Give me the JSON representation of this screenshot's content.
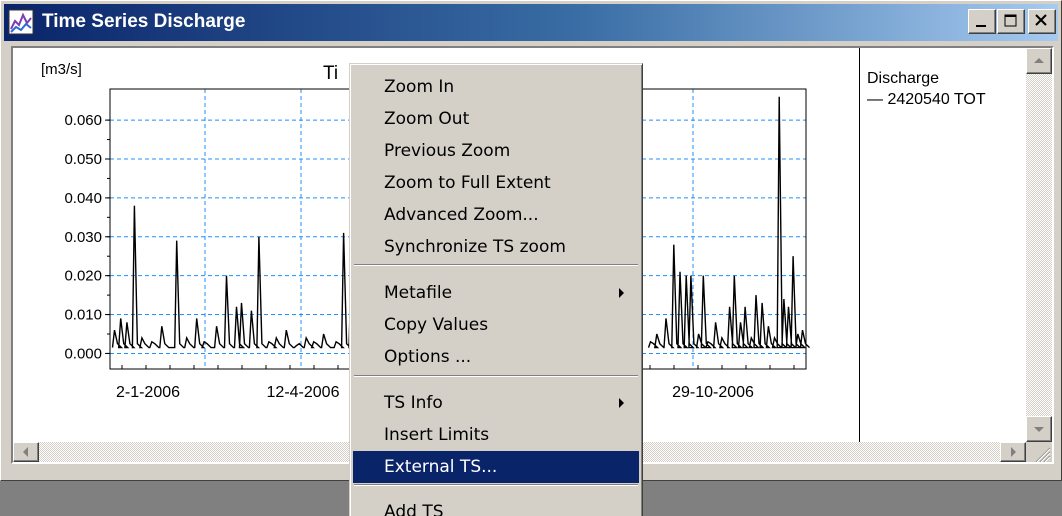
{
  "window": {
    "title": "Time Series Discharge",
    "min_glyph": "_",
    "max_glyph": "□",
    "close_glyph": "✕"
  },
  "chart_data": {
    "type": "line",
    "title": "Ti",
    "ylabel": "[m3/s]",
    "ylim": [
      -0.004,
      0.068
    ],
    "yticks": [
      0.0,
      0.01,
      0.02,
      0.03,
      0.04,
      0.05,
      0.06
    ],
    "ytick_labels": [
      "0.000",
      "0.010",
      "0.020",
      "0.030",
      "0.040",
      "0.050",
      "0.060"
    ],
    "xtick_labels": [
      "2-1-2006",
      "12-4-2006",
      "29-10-2006"
    ],
    "grid": true,
    "legend_title": "Discharge",
    "legend_position": "right",
    "series": [
      {
        "name": "2420540 TOT",
        "color": "#000000",
        "peaks_left": [
          [
            0.01,
            0.006
          ],
          [
            0.035,
            0.009
          ],
          [
            0.06,
            0.008
          ],
          [
            0.09,
            0.038
          ],
          [
            0.12,
            0.004
          ],
          [
            0.16,
            0.003
          ],
          [
            0.2,
            0.007
          ],
          [
            0.26,
            0.029
          ],
          [
            0.3,
            0.004
          ],
          [
            0.34,
            0.009
          ],
          [
            0.37,
            0.003
          ],
          [
            0.42,
            0.007
          ],
          [
            0.46,
            0.02
          ],
          [
            0.5,
            0.012
          ],
          [
            0.52,
            0.013
          ],
          [
            0.56,
            0.011
          ],
          [
            0.59,
            0.03
          ],
          [
            0.63,
            0.003
          ],
          [
            0.66,
            0.004
          ],
          [
            0.7,
            0.006
          ],
          [
            0.74,
            0.002
          ],
          [
            0.78,
            0.004
          ],
          [
            0.81,
            0.003
          ],
          [
            0.85,
            0.005
          ],
          [
            0.9,
            0.003
          ],
          [
            0.93,
            0.031
          ],
          [
            0.96,
            0.02
          ],
          [
            0.99,
            0.012
          ]
        ],
        "peaks_right": [
          [
            0.01,
            0.003
          ],
          [
            0.05,
            0.005
          ],
          [
            0.11,
            0.009
          ],
          [
            0.16,
            0.028
          ],
          [
            0.2,
            0.021
          ],
          [
            0.24,
            0.02
          ],
          [
            0.27,
            0.02
          ],
          [
            0.32,
            0.005
          ],
          [
            0.35,
            0.02
          ],
          [
            0.38,
            0.003
          ],
          [
            0.43,
            0.008
          ],
          [
            0.47,
            0.004
          ],
          [
            0.52,
            0.012
          ],
          [
            0.55,
            0.02
          ],
          [
            0.59,
            0.008
          ],
          [
            0.62,
            0.012
          ],
          [
            0.66,
            0.004
          ],
          [
            0.69,
            0.015
          ],
          [
            0.73,
            0.013
          ],
          [
            0.77,
            0.007
          ],
          [
            0.81,
            0.004
          ],
          [
            0.84,
            0.066
          ],
          [
            0.87,
            0.014
          ],
          [
            0.9,
            0.012
          ],
          [
            0.93,
            0.025
          ],
          [
            0.96,
            0.005
          ],
          [
            0.99,
            0.006
          ]
        ]
      }
    ]
  },
  "context_menu": {
    "items": [
      {
        "label": "Zoom In"
      },
      {
        "label": "Zoom Out"
      },
      {
        "label": "Previous Zoom"
      },
      {
        "label": "Zoom to Full Extent"
      },
      {
        "label": "Advanced Zoom..."
      },
      {
        "label": "Synchronize TS zoom"
      },
      {
        "label": "Metafile"
      },
      {
        "label": "Copy Values"
      },
      {
        "label": "Options ..."
      },
      {
        "label": "TS Info"
      },
      {
        "label": "Insert Limits"
      },
      {
        "label": "External TS..."
      },
      {
        "label": "Add TS"
      }
    ],
    "selected": "External TS..."
  },
  "colors": {
    "grid": "#1e90ff",
    "selection": "#0a246a",
    "title_gradient_start": "#0a246a",
    "title_gradient_end": "#a6caf0"
  }
}
